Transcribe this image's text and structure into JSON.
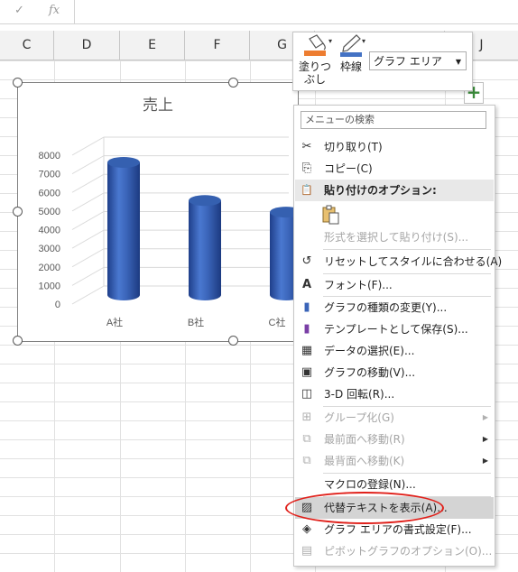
{
  "formula_bar": {
    "check_icon": "✓",
    "fx_label": "fx"
  },
  "columns": [
    "C",
    "D",
    "E",
    "F",
    "G",
    "J"
  ],
  "chart_data": {
    "type": "bar",
    "title": "売上",
    "categories": [
      "A社",
      "B社",
      "C社"
    ],
    "values": [
      8000,
      5700,
      5000
    ],
    "ylim": [
      0,
      8000
    ],
    "yticks": [
      "0",
      "1000",
      "2000",
      "3000",
      "4000",
      "5000",
      "6000",
      "7000",
      "8000"
    ],
    "bar_color": "#3a64b8",
    "style": "3d-cylinder",
    "xlabel": "",
    "ylabel": ""
  },
  "mini_toolbar": {
    "fill_label_1": "塗りつ",
    "fill_label_2": "ぶし",
    "outline_label": "枠線",
    "element_selector": "グラフ エリア"
  },
  "context_menu": {
    "search_placeholder": "メニューの検索",
    "items": [
      {
        "label": "切り取り(T)",
        "icon": "scissors-icon",
        "glyph": "✂"
      },
      {
        "label": "コピー(C)",
        "icon": "copy-icon",
        "glyph": "⎘"
      },
      {
        "label": "貼り付けのオプション:",
        "icon": "paste-icon",
        "glyph": "📋"
      },
      {
        "label": "形式を選択して貼り付け(S)...",
        "icon": "",
        "glyph": ""
      },
      {
        "label": "リセットしてスタイルに合わせる(A)",
        "icon": "reset-style-icon",
        "glyph": "↺"
      },
      {
        "label": "フォント(F)...",
        "icon": "font-icon",
        "glyph": "A"
      },
      {
        "label": "グラフの種類の変更(Y)...",
        "icon": "chart-type-icon",
        "glyph": "▮"
      },
      {
        "label": "テンプレートとして保存(S)...",
        "icon": "save-template-icon",
        "glyph": "▮"
      },
      {
        "label": "データの選択(E)...",
        "icon": "select-data-icon",
        "glyph": "▦"
      },
      {
        "label": "グラフの移動(V)...",
        "icon": "move-chart-icon",
        "glyph": "▣"
      },
      {
        "label": "3-D 回転(R)...",
        "icon": "rotate-3d-icon",
        "glyph": "◫"
      },
      {
        "label": "グループ化(G)",
        "icon": "group-icon",
        "glyph": "⊞"
      },
      {
        "label": "最前面へ移動(R)",
        "icon": "bring-front-icon",
        "glyph": "⧉"
      },
      {
        "label": "最背面へ移動(K)",
        "icon": "send-back-icon",
        "glyph": "⧉"
      },
      {
        "label": "マクロの登録(N)...",
        "icon": "",
        "glyph": ""
      },
      {
        "label": "代替テキストを表示(A)...",
        "icon": "alt-text-icon",
        "glyph": "▨"
      },
      {
        "label": "グラフ エリアの書式設定(F)...",
        "icon": "format-chart-area-icon",
        "glyph": "◈"
      },
      {
        "label": "ピボットグラフのオプション(O)...",
        "icon": "pivot-chart-options-icon",
        "glyph": "▤"
      }
    ]
  },
  "colors": {
    "fill_swatch": "#ed7d31",
    "outline_swatch": "#4472c4",
    "highlight_ellipse": "#e0201a"
  }
}
